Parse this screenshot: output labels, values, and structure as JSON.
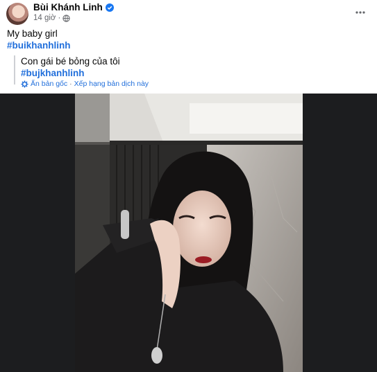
{
  "post": {
    "author": "Bùi Khánh Linh",
    "time": "14 giờ",
    "text": "My baby girl",
    "hashtag": "#buikhanhlinh"
  },
  "translation": {
    "text": "Con gái bé bỏng của tôi",
    "hashtag": "#bujkhanhlinh",
    "hide_original": "Ẩn bản gốc",
    "separator": "·",
    "rate_translation": "Xếp hạng bản dịch này"
  },
  "icons": {
    "verified": "verified-badge-icon",
    "privacy": "globe-icon",
    "more": "more-options-icon",
    "translate": "gear-icon"
  },
  "colors": {
    "accent": "#216fdb",
    "secondary_text": "#65676b",
    "media_background": "#1c1d1f"
  }
}
